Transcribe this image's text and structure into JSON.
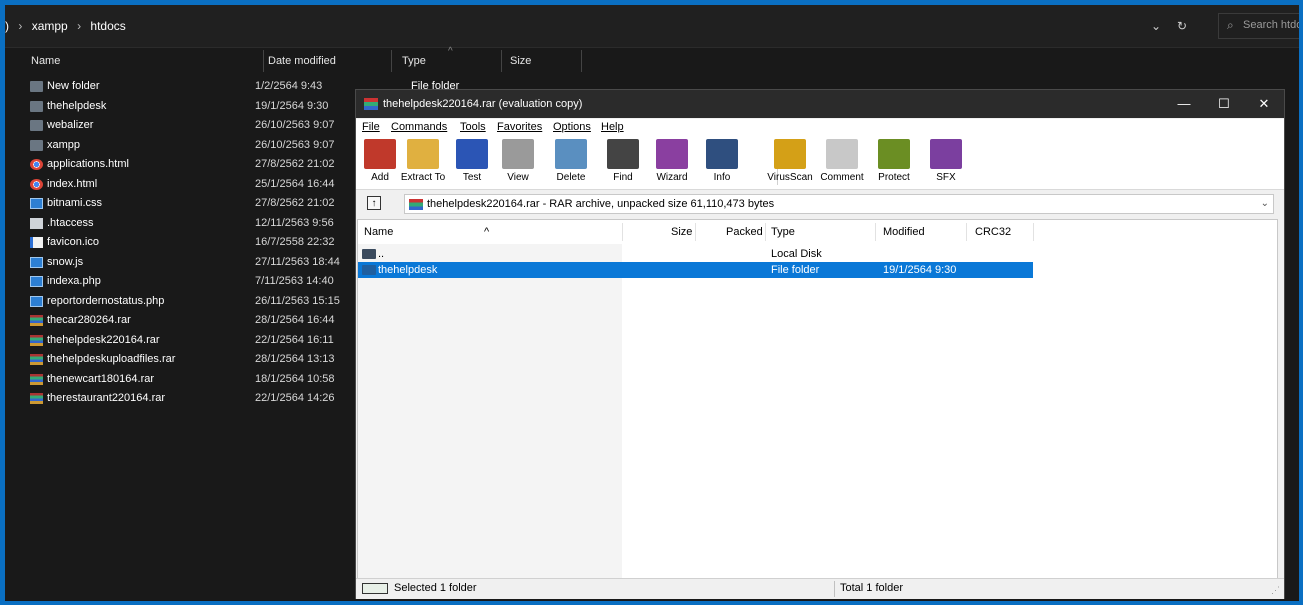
{
  "explorer": {
    "breadcrumb": [
      ")",
      "xampp",
      "htdocs"
    ],
    "search_placeholder": "Search htdo",
    "columns": [
      "Name",
      "Date modified",
      "Type",
      "Size"
    ],
    "files": [
      {
        "name": "New folder",
        "date": "1/2/2564 9:43",
        "icon": "folder-icon"
      },
      {
        "name": "thehelpdesk",
        "date": "19/1/2564 9:30",
        "icon": "folder-icon"
      },
      {
        "name": "webalizer",
        "date": "26/10/2563 9:07",
        "icon": "folder-icon"
      },
      {
        "name": "xampp",
        "date": "26/10/2563 9:07",
        "icon": "folder-icon"
      },
      {
        "name": "applications.html",
        "date": "27/8/2562 21:02",
        "icon": "chrome-icon"
      },
      {
        "name": "index.html",
        "date": "25/1/2564 16:44",
        "icon": "chrome-icon"
      },
      {
        "name": "bitnami.css",
        "date": "27/8/2562 21:02",
        "icon": "code-file-icon"
      },
      {
        "name": ".htaccess",
        "date": "12/11/2563 9:56",
        "icon": "file-icon"
      },
      {
        "name": "favicon.ico",
        "date": "16/7/2558 22:32",
        "icon": "ico-file-icon"
      },
      {
        "name": "snow.js",
        "date": "27/11/2563 18:44",
        "icon": "code-file-icon"
      },
      {
        "name": "indexa.php",
        "date": "7/11/2563 14:40",
        "icon": "code-file-icon"
      },
      {
        "name": "reportordernostatus.php",
        "date": "26/11/2563 15:15",
        "icon": "code-file-icon"
      },
      {
        "name": "thecar280264.rar",
        "date": "28/1/2564 16:44",
        "icon": "rar-icon"
      },
      {
        "name": "thehelpdesk220164.rar",
        "date": "22/1/2564 16:11",
        "icon": "rar-icon"
      },
      {
        "name": "thehelpdeskuploadfiles.rar",
        "date": "28/1/2564 13:13",
        "icon": "rar-icon"
      },
      {
        "name": "thenewcart180164.rar",
        "date": "18/1/2564 10:58",
        "icon": "rar-icon"
      },
      {
        "name": "therestaurant220164.rar",
        "date": "22/1/2564 14:26",
        "icon": "rar-icon"
      }
    ],
    "partial_type": "File folder"
  },
  "winrar": {
    "title": "thehelpdesk220164.rar (evaluation copy)",
    "window_buttons": {
      "minimize": "—",
      "maximize": "☐",
      "close": "✕"
    },
    "menu": [
      "File",
      "Commands",
      "Tools",
      "Favorites",
      "Options",
      "Help"
    ],
    "toolbar": [
      {
        "label": "Add",
        "icon": "add-archive-icon",
        "color": "#c0392b"
      },
      {
        "label": "Extract To",
        "icon": "extract-folder-icon",
        "color": "#e0b040"
      },
      {
        "label": "Test",
        "icon": "test-icon",
        "color": "#2b55b5"
      },
      {
        "label": "View",
        "icon": "view-glasses-icon",
        "color": "#9a9a9a"
      },
      {
        "label": "Delete",
        "icon": "delete-icon",
        "color": "#5a8fc0"
      },
      {
        "label": "Find",
        "icon": "find-binoculars-icon",
        "color": "#444444"
      },
      {
        "label": "Wizard",
        "icon": "wizard-icon",
        "color": "#8a3fa0"
      },
      {
        "label": "Info",
        "icon": "info-icon",
        "color": "#2f4f7f"
      },
      {
        "label": "VirusScan",
        "icon": "virus-scan-icon",
        "color": "#d4a017"
      },
      {
        "label": "Comment",
        "icon": "comment-icon",
        "color": "#c8c8c8"
      },
      {
        "label": "Protect",
        "icon": "protect-shield-icon",
        "color": "#6b8e23"
      },
      {
        "label": "SFX",
        "icon": "sfx-icon",
        "color": "#7b3f9f"
      }
    ],
    "path_text": "thehelpdesk220164.rar - RAR archive, unpacked size 61,110,473 bytes",
    "columns": [
      "Name",
      "Size",
      "Packed",
      "Type",
      "Modified",
      "CRC32"
    ],
    "rows": [
      {
        "name": "..",
        "size": "",
        "packed": "",
        "type": "Local Disk",
        "modified": "",
        "crc": "",
        "selected": false
      },
      {
        "name": "thehelpdesk",
        "size": "",
        "packed": "",
        "type": "File folder",
        "modified": "19/1/2564 9:30",
        "crc": "",
        "selected": true
      }
    ],
    "status_left": "Selected 1 folder",
    "status_right": "Total 1 folder"
  }
}
